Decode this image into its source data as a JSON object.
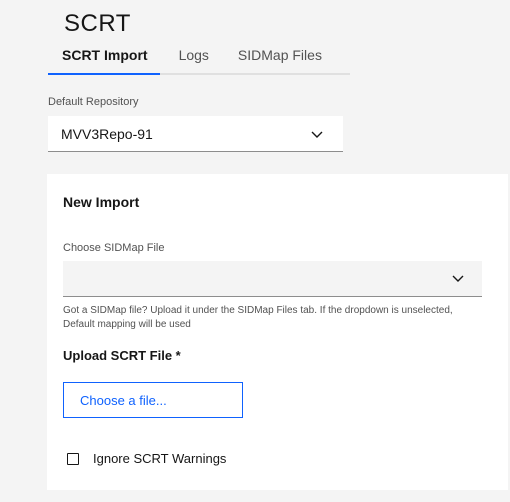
{
  "page": {
    "title": "SCRT"
  },
  "tabs": [
    {
      "label": "SCRT Import",
      "active": true
    },
    {
      "label": "Logs",
      "active": false
    },
    {
      "label": "SIDMap Files",
      "active": false
    }
  ],
  "default_repository": {
    "label": "Default Repository",
    "value": "MVV3Repo-91",
    "icon": "chevron-down-icon"
  },
  "new_import": {
    "title": "New Import",
    "sidmap": {
      "label": "Choose SIDMap File",
      "value": "",
      "icon": "chevron-down-icon"
    },
    "helper_text": "Got a SIDMap file? Upload it under the SIDMap Files tab. If the dropdown is unselected, Default mapping will be used",
    "upload": {
      "title": "Upload SCRT File *",
      "button_label": "Choose a file..."
    },
    "ignore_warnings": {
      "label": "Ignore SCRT Warnings",
      "checked": false
    }
  },
  "colors": {
    "accent": "#0f62fe",
    "background": "#f4f4f4",
    "panel": "#ffffff",
    "text": "#161616",
    "secondary_text": "#525252"
  }
}
